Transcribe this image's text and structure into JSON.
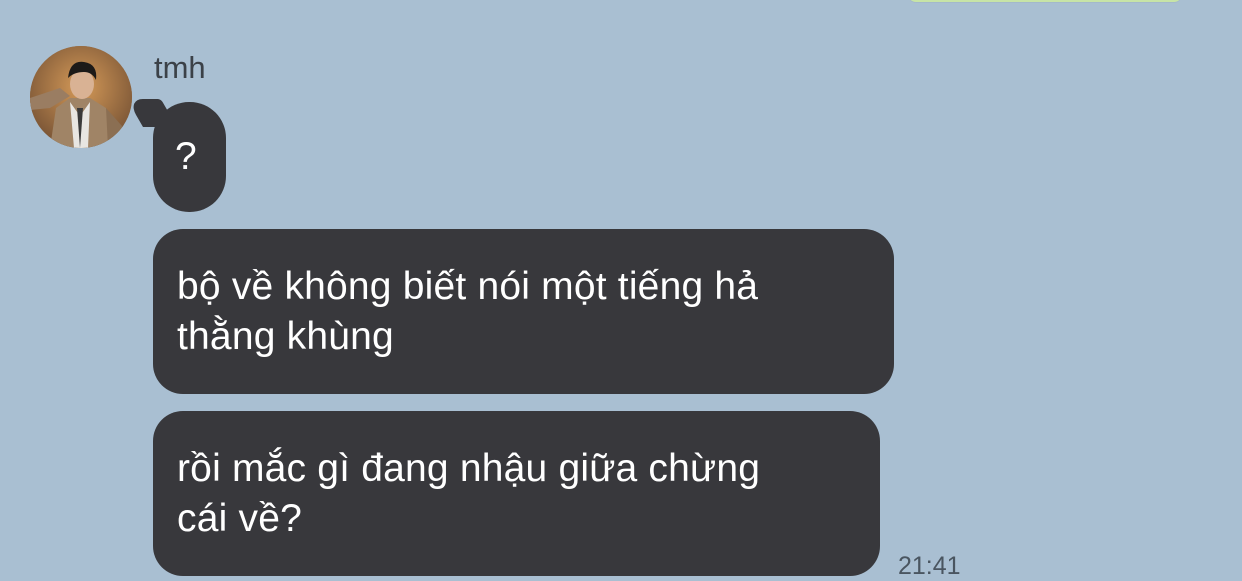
{
  "chat": {
    "sender_name": "tmh",
    "messages": [
      {
        "text": "?"
      },
      {
        "line1": "bộ về không biết nói một tiếng hả",
        "line2": "thằng khùng"
      },
      {
        "line1": "rồi mắc gì đang nhậu giữa chừng",
        "line2": "cái về?"
      }
    ],
    "timestamp": "21:41"
  },
  "icons": {
    "avatar": "profile-photo"
  },
  "colors": {
    "background": "#a9bfd2",
    "bubble": "#38383c",
    "bubble_text": "#ffffff",
    "outgoing_bubble": "#c7e4a7"
  }
}
